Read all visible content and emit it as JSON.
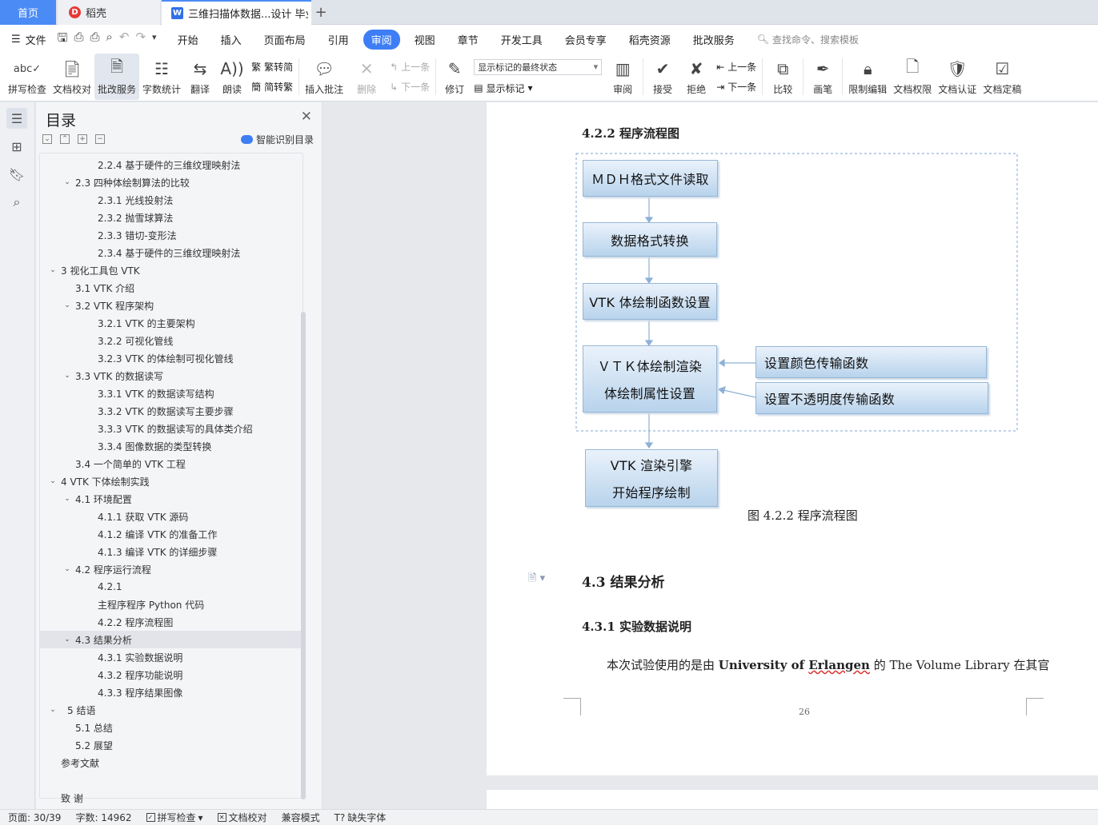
{
  "tabs": {
    "home": "首页",
    "daoke": "稻壳",
    "doc": "三维扫描体数据...设计 毕业设",
    "add": "+"
  },
  "menu": {
    "file": "文件",
    "items": [
      "开始",
      "插入",
      "页面布局",
      "引用",
      "审阅",
      "视图",
      "章节",
      "开发工具",
      "会员专享",
      "稻壳资源",
      "批改服务"
    ],
    "active": "审阅",
    "search": "查找命令、搜索模板"
  },
  "ribbon": {
    "spell": "拼写检查",
    "doccheck": "文档校对",
    "grading": "批改服务",
    "wordcount": "字数统计",
    "translate": "翻译",
    "read": "朗读",
    "trad_to_simp": "繁转简",
    "simp_to_trad": "简转繁",
    "insert_comment": "插入批注",
    "delete": "删除",
    "prev_comment": "上一条",
    "next_comment": "下一条",
    "revise": "修订",
    "markup_state": "显示标记的最终状态",
    "show_markup": "显示标记",
    "review": "审阅",
    "accept": "接受",
    "reject": "拒绝",
    "prev_change": "上一条",
    "next_change": "下一条",
    "compare": "比较",
    "pen": "画笔",
    "restrict": "限制编辑",
    "permission": "文档权限",
    "certify": "文档认证",
    "finalize": "文档定稿"
  },
  "toc": {
    "title": "目录",
    "smart": "智能识别目录",
    "items": [
      {
        "text": "2.2.4  基于硬件的三维纹理映射法",
        "level": 3
      },
      {
        "text": "2.3  四种体绘制算法的比较",
        "level": 2,
        "caret": "v"
      },
      {
        "text": "2.3.1  光线投射法",
        "level": 3
      },
      {
        "text": "2.3.2  抛雪球算法",
        "level": 3
      },
      {
        "text": "2.3.3  错切-变形法",
        "level": 3
      },
      {
        "text": "2.3.4  基于硬件的三维纹理映射法",
        "level": 3
      },
      {
        "text": "3  视化工具包 VTK",
        "level": 1,
        "caret": "v"
      },
      {
        "text": "3.1 VTK 介绍",
        "level": 2
      },
      {
        "text": "3.2 VTK 程序架构",
        "level": 2,
        "caret": "v"
      },
      {
        "text": "3.2.1 VTK 的主要架构",
        "level": 3
      },
      {
        "text": "3.2.2  可视化管线",
        "level": 3
      },
      {
        "text": "3.2.3 VTK 的体绘制可视化管线",
        "level": 3
      },
      {
        "text": "3.3 VTK 的数据读写",
        "level": 2,
        "caret": "v"
      },
      {
        "text": "3.3.1 VTK 的数据读写结构",
        "level": 3
      },
      {
        "text": "3.3.2 VTK 的数据读写主要步骤",
        "level": 3
      },
      {
        "text": "3.3.3 VTK 的数据读写的具体类介绍",
        "level": 3
      },
      {
        "text": "3.3.4  图像数据的类型转换",
        "level": 3
      },
      {
        "text": "3.4  一个简单的 VTK 工程",
        "level": 2
      },
      {
        "text": "4 VTK 下体绘制实践",
        "level": 1,
        "caret": "v"
      },
      {
        "text": "4.1  环境配置",
        "level": 2,
        "caret": "v"
      },
      {
        "text": "4.1.1  获取 VTK 源码",
        "level": 3
      },
      {
        "text": "4.1.2  编译 VTK 的准备工作",
        "level": 3
      },
      {
        "text": "4.1.3  编译 VTK 的详细步骤",
        "level": 3
      },
      {
        "text": "4.2  程序运行流程",
        "level": 2,
        "caret": "v"
      },
      {
        "text": "4.2.1",
        "level": 3
      },
      {
        "text": "主程序程序 Python 代码",
        "level": 3
      },
      {
        "text": "4.2.2  程序流程图",
        "level": 3
      },
      {
        "text": "4.3  结果分析",
        "level": 2,
        "caret": "v",
        "selected": true
      },
      {
        "text": "4.3.1  实验数据说明",
        "level": 3
      },
      {
        "text": "4.3.2  程序功能说明",
        "level": 3
      },
      {
        "text": "4.3.3  程序结果图像",
        "level": 3
      },
      {
        "text": "5  结语",
        "level": 1,
        "caret": "v",
        "extra": true
      },
      {
        "text": "5.1  总结",
        "level": 2
      },
      {
        "text": "5.2  展望",
        "level": 2
      },
      {
        "text": "参考文献",
        "level": 1
      },
      {
        "text": "",
        "level": 1
      },
      {
        "text": "致    谢",
        "level": 1
      }
    ]
  },
  "document": {
    "heading_422": "4.2.2  程序流程图",
    "flow": {
      "read": "ＭＤＨ格式文件读取",
      "convert": "数据格式转换",
      "func": "VTK 体绘制函数设置",
      "render1": "ＶＴＫ体绘制渲染",
      "render2": "体绘制属性设置",
      "color": "设置颜色传输函数",
      "opacity": "设置不透明度传输函数",
      "engine1": "VTK 渲染引擎",
      "engine2": "开始程序绘制"
    },
    "caption": "图 4.2.2  程序流程图",
    "heading_43": "4.3  结果分析",
    "heading_431": "4.3.1  实验数据说明",
    "para_prefix": "本次试验使用的是由 ",
    "para_bold1": "University of ",
    "para_bold2": "Erlangen",
    "para_mid": " 的 ",
    "para_roman": "The Volume Library",
    "para_suffix": " 在其官",
    "page_number": "26"
  },
  "status": {
    "page": "页面: 30/39",
    "words": "字数: 14962",
    "spell": "拼写检查",
    "proof": "文档校对",
    "compat": "兼容模式",
    "missing_font": "缺失字体"
  }
}
